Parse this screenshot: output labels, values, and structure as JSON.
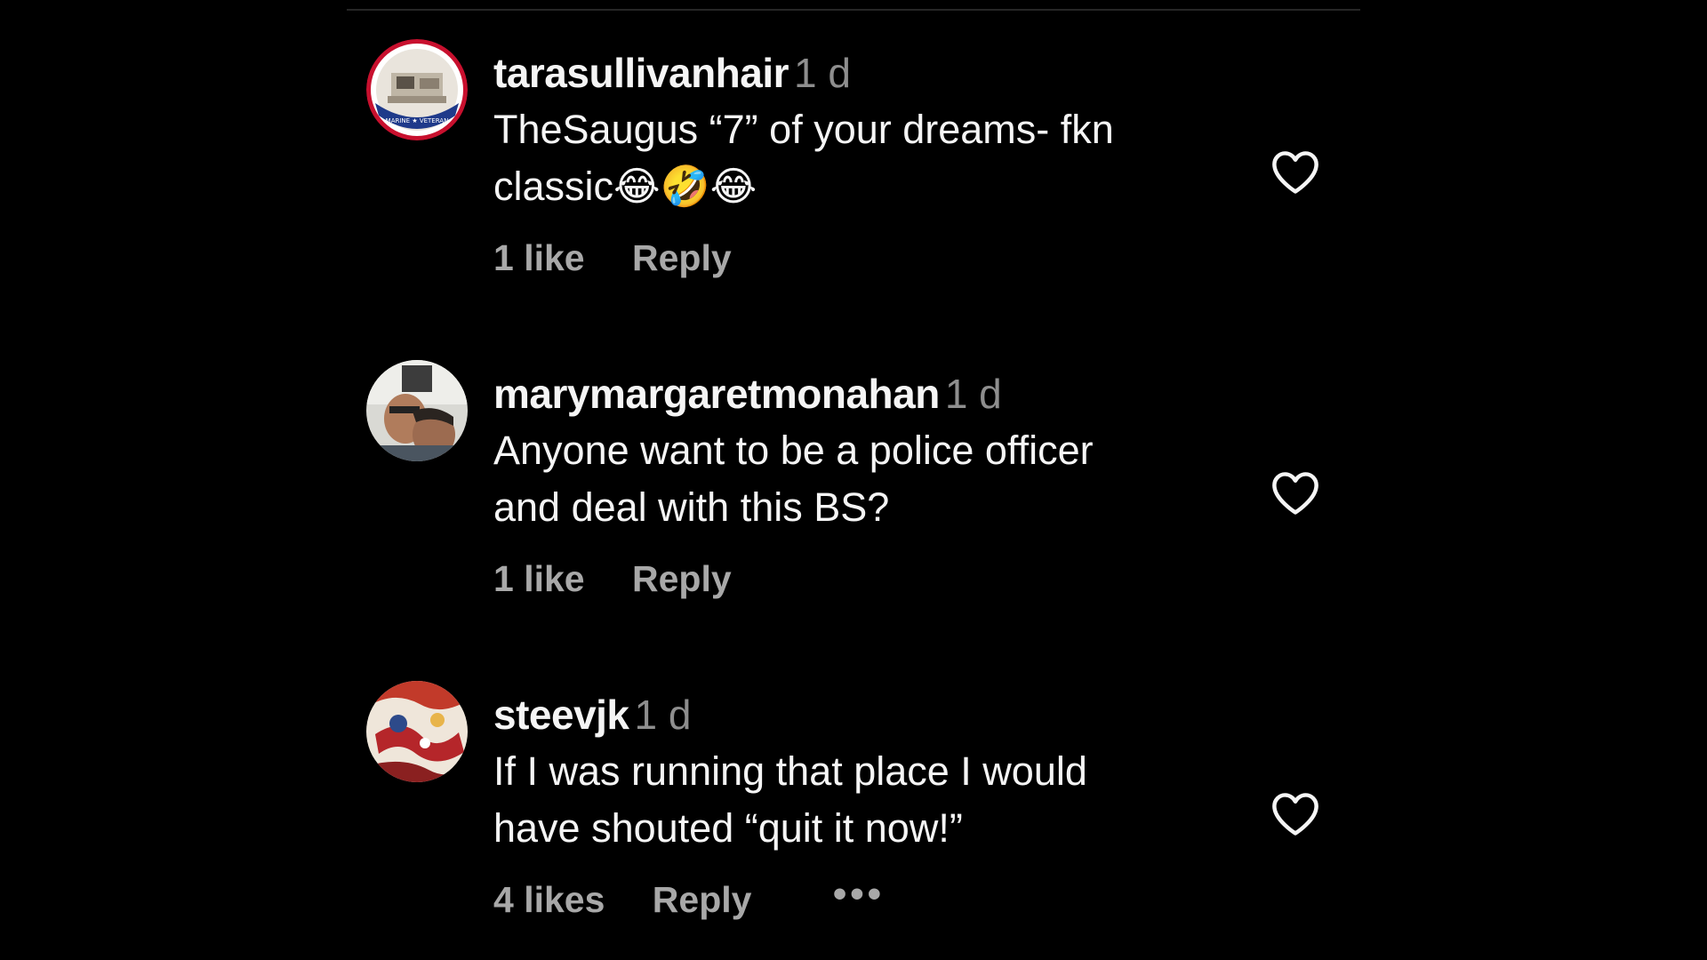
{
  "comments": [
    {
      "username": "tarasullivanhair",
      "time": "1 d",
      "text_line1": "TheSaugus “7” of your dreams- fkn",
      "text_line2": "classic",
      "emojis": "😂🤣😂",
      "likes": "1 like",
      "reply": "Reply",
      "avatar_text": "MARINE ★ VETERAN"
    },
    {
      "username": "marymargaretmonahan",
      "time": "1 d",
      "text_line1": "Anyone want to be a police officer",
      "text_line2": "and deal with this BS?",
      "likes": "1 like",
      "reply": "Reply"
    },
    {
      "username": "steevjk",
      "time": "1 d",
      "text_line1": "If I was running that place I would",
      "text_line2": "have shouted “quit it now!”",
      "likes": "4 likes",
      "reply": "Reply",
      "more": "•••"
    }
  ],
  "icons": {
    "like": "heart-outline-icon",
    "more": "more-horizontal-icon"
  },
  "colors": {
    "background": "#000000",
    "text": "#f5f5f5",
    "secondary": "#8e8e8e",
    "actions": "#a8a8a8"
  }
}
